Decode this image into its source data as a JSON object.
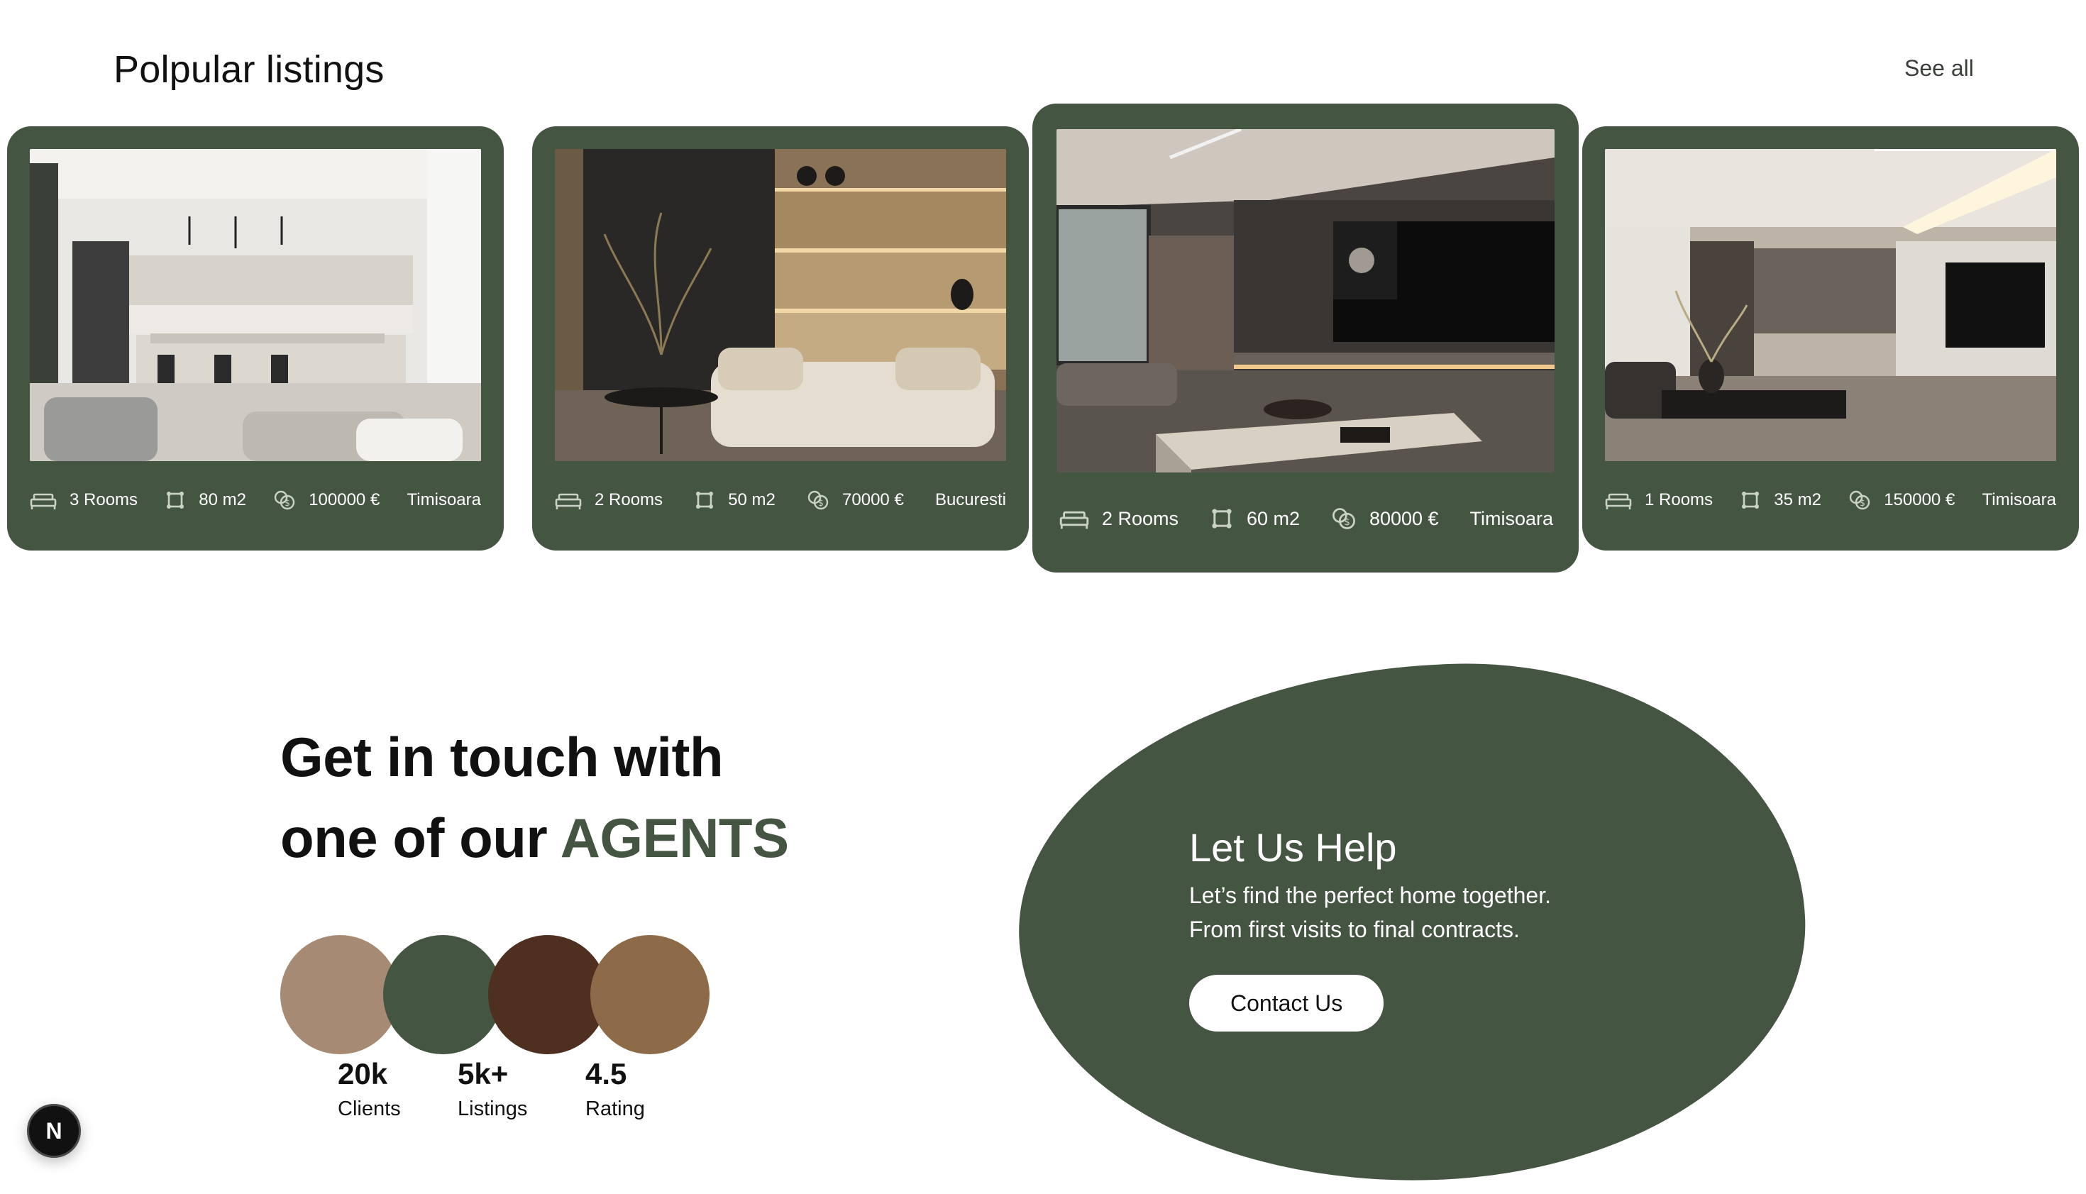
{
  "section": {
    "title": "Polpular listings",
    "see_all": "See all"
  },
  "listings": [
    {
      "rooms": "3 Rooms",
      "area": "80 m2",
      "price": "100000 €",
      "city": "Timisoara",
      "photo": "modern-kitchen-photo"
    },
    {
      "rooms": "2 Rooms",
      "area": "50 m2",
      "price": "70000 €",
      "city": "Bucuresti",
      "photo": "living-room-shelves-photo"
    },
    {
      "rooms": "2 Rooms",
      "area": "60 m2",
      "price": "80000 €",
      "city": "Timisoara",
      "photo": "dark-living-room-photo"
    },
    {
      "rooms": "1 Rooms",
      "area": "35 m2",
      "price": "150000 €",
      "city": "Timisoara",
      "photo": "open-plan-living-photo"
    }
  ],
  "agents": {
    "heading_line1": "Get in touch with",
    "heading_line2_prefix": "one of our ",
    "heading_accent": "AGENTS",
    "stats": [
      {
        "value": "20k",
        "label": "Clients"
      },
      {
        "value": "5k+",
        "label": "Listings"
      },
      {
        "value": "4.5",
        "label": "Rating"
      }
    ]
  },
  "help": {
    "title": "Let Us Help",
    "line1": "Let’s find the perfect home together.",
    "line2": "From first visits to final contracts.",
    "button": "Contact Us"
  },
  "badge": {
    "label": "N"
  },
  "colors": {
    "brand_green": "#445641",
    "circle_tan": "#a78a73",
    "circle_green": "#445641",
    "circle_dark_brown": "#4f3020",
    "circle_brown": "#8d6a48",
    "white": "#ffffff"
  },
  "icons": {
    "rooms": "bed-icon",
    "area": "area-frame-icon",
    "price": "coins-icon"
  }
}
